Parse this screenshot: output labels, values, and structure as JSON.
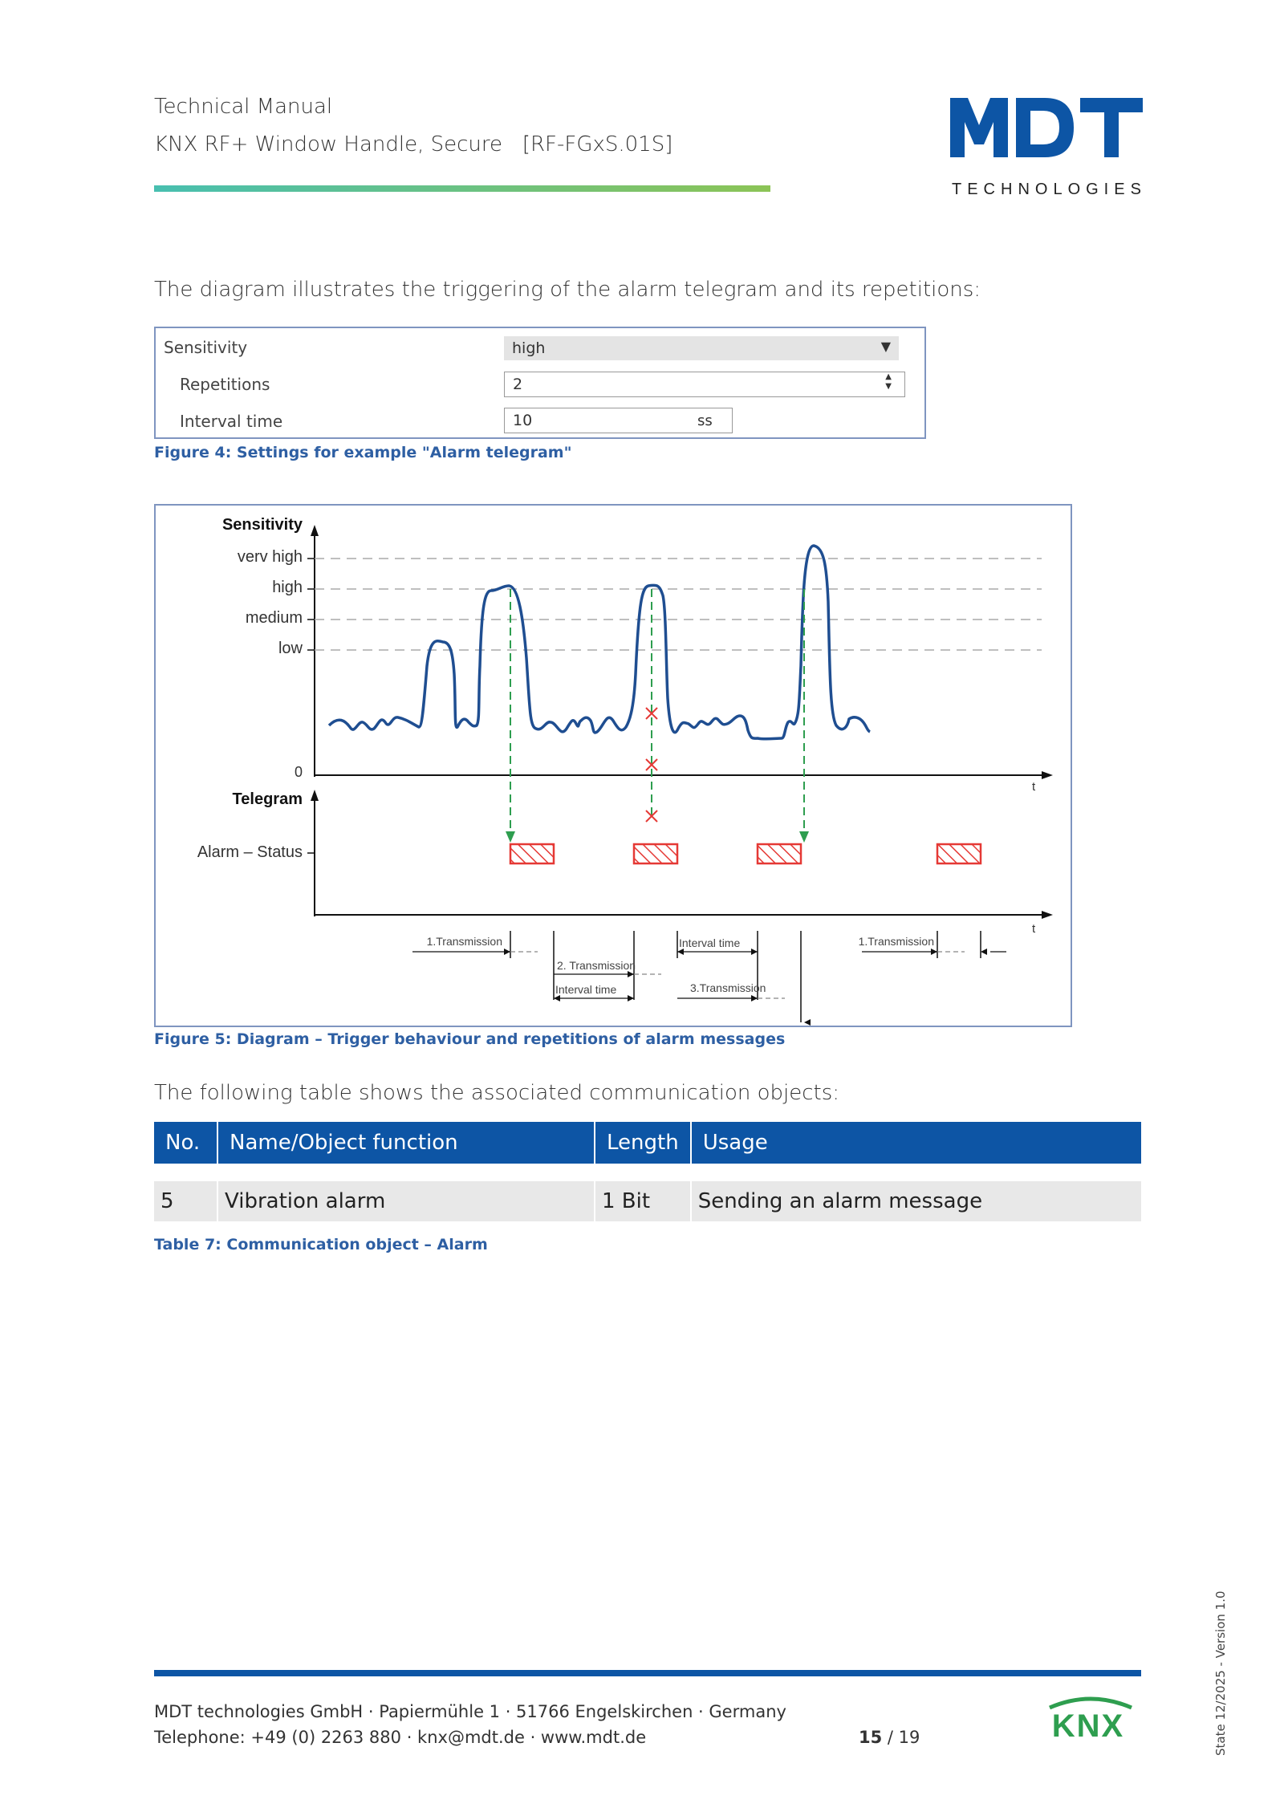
{
  "header": {
    "title": "Technical Manual",
    "subtitle": "KNX RF+ Window Handle, Secure   [RF-FGxS.01S]",
    "logo_text": "MDT",
    "logo_subtext": "TECHNOLOGIES",
    "brand_color": "#0d55a5"
  },
  "intro": "The diagram illustrates the triggering of the alarm telegram and its repetitions:",
  "settings": {
    "rows": [
      {
        "label": "Sensitivity",
        "value": "high"
      },
      {
        "label": "Repetitions",
        "value": "2"
      },
      {
        "label": "Interval time",
        "value": "10",
        "unit": "ss"
      }
    ],
    "caption": "Figure 4: Settings for example \"Alarm telegram\""
  },
  "diagram": {
    "y_title": "Sensitivity",
    "levels": [
      "verv high",
      "high",
      "medium",
      "low",
      "0"
    ],
    "t_label": "t",
    "telegram_title": "Telegram",
    "alarm_label": "Alarm – Status",
    "timing_labels": [
      "1.Transmission",
      "2. Transmission",
      "Interval time",
      "Interval time",
      "3.Transmission",
      "1.Transmission"
    ],
    "caption": "Figure 5: Diagram – Trigger behaviour and repetitions of alarm messages",
    "colors": {
      "signal": "#1f4e91",
      "alarm": "#e53935",
      "trigger": "#2e9e4f"
    }
  },
  "intro2": "The following table shows the associated communication objects:",
  "table": {
    "headers": [
      "No.",
      "Name/Object function",
      "Length",
      "Usage"
    ],
    "rows": [
      [
        "5",
        "Vibration alarm",
        "1 Bit",
        "Sending an alarm message"
      ]
    ],
    "caption": "Table 7: Communication object – Alarm"
  },
  "footer": {
    "line1": "MDT technologies GmbH · Papiermühle 1 · 51766 Engelskirchen · Germany",
    "line2": "Telephone: +49 (0) 2263 880 · knx@mdt.de · www.mdt.de",
    "page_current": "15",
    "page_total": " / 19",
    "state": "State 12/2025 - Version 1.0",
    "knx_logo": "KNX"
  }
}
